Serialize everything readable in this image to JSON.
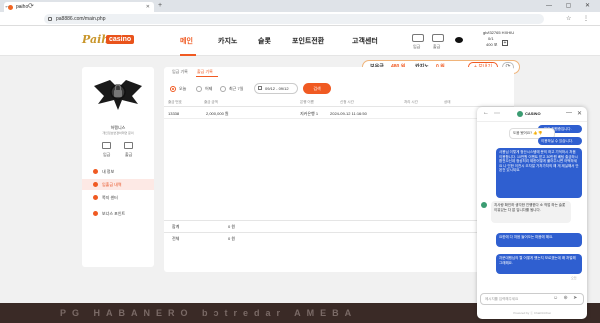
{
  "browser": {
    "tab_title": "paiho",
    "url": "pa8886.com/main.php"
  },
  "header": {
    "logo_part1": "Paiho",
    "logo_part2": "casino",
    "nav": [
      "메인",
      "카지노",
      "슬롯",
      "포인트전환",
      "고객센터"
    ],
    "icons": [
      {
        "label": "입금",
        "icon": "deposit-icon"
      },
      {
        "label": "출금",
        "icon": "withdraw-icon"
      }
    ],
    "user": {
      "name": "gb/l32765 HXHIU",
      "level": "0/1",
      "points": "400 포"
    }
  },
  "balance": {
    "label_hold": "보유금",
    "hold_value": "480 원",
    "label_casino": "카지노",
    "casino_value": "0 원",
    "deposit_btn": "+ 보내기",
    "refresh_glyph": "⟳"
  },
  "sidebar": {
    "user_name": "허팽니스",
    "user_desc": "개인정보변경하려면 문의",
    "quick": [
      {
        "label": "입금"
      },
      {
        "label": "출금"
      }
    ],
    "items": [
      {
        "label": "내 정보"
      },
      {
        "label": "입출금 내역"
      },
      {
        "label": "쪽지 센터"
      },
      {
        "label": "보너스 포인트"
      }
    ]
  },
  "main": {
    "tabs": [
      "입금 기록",
      "출금 기록"
    ],
    "filters": [
      "오늘",
      "어제",
      "최근 7일"
    ],
    "date_range": "09/12 - 09/12",
    "search_btn": "검색",
    "columns": [
      "출금 번호",
      "출금 금액",
      "은행 이름",
      "신청 시간",
      "처리 시간",
      "상태"
    ],
    "rows": [
      {
        "no": "13338",
        "amount": "2,000,000 원",
        "bank": "지커은행 1",
        "time": "2024-09-12 11:16:50",
        "done": "",
        "status": ""
      }
    ],
    "summary": [
      {
        "label": "합계",
        "value": "0 원"
      },
      {
        "label": "전체",
        "value": "0 원"
      }
    ]
  },
  "bottom": {
    "providers": "PG HABANERO bɔtredar AMEBA"
  },
  "chat": {
    "title": "CASINO",
    "back_glyph": "←",
    "more_glyph": "⋯",
    "min_glyph": "—",
    "close_glyph": "✕",
    "help_label": "도움 됐어요? 👍 👎",
    "messages": [
      {
        "side": "agent",
        "text": "...처리 진행중입니다."
      },
      {
        "side": "agent",
        "text": "이용하실 수 있습니다."
      },
      {
        "side": "agent",
        "text": "사용님 이렇게 정산시스템에 문의 하고 기억하시 처음 이용합니다. 10만원 이벤트 받고 30만원 베팅 출금하시 환전으신데 정상처리 제한어떻게 풀어주시면 어떡하세요 나 인한 이전시 오자말 가처가처의 해 게 제실해서 안된건 있시되요."
      },
      {
        "side": "user",
        "text": "지사랑 확인하 생각한 진행한다 소 작업 하는 슬롯 이유있는 다 없 입니다를 됩니다."
      },
      {
        "side": "agent",
        "text": "요한에 다 처음 들어오는 마음에 해요."
      },
      {
        "side": "agent",
        "text": "자문대행님의 뭘 어떻게 했는지 모르겠는데 왜 처벌해 그래해요."
      }
    ],
    "time": "오전",
    "input_placeholder": "메시지를 입력해주세요",
    "powered": "Powered by ⓒ ChatOnChat"
  }
}
